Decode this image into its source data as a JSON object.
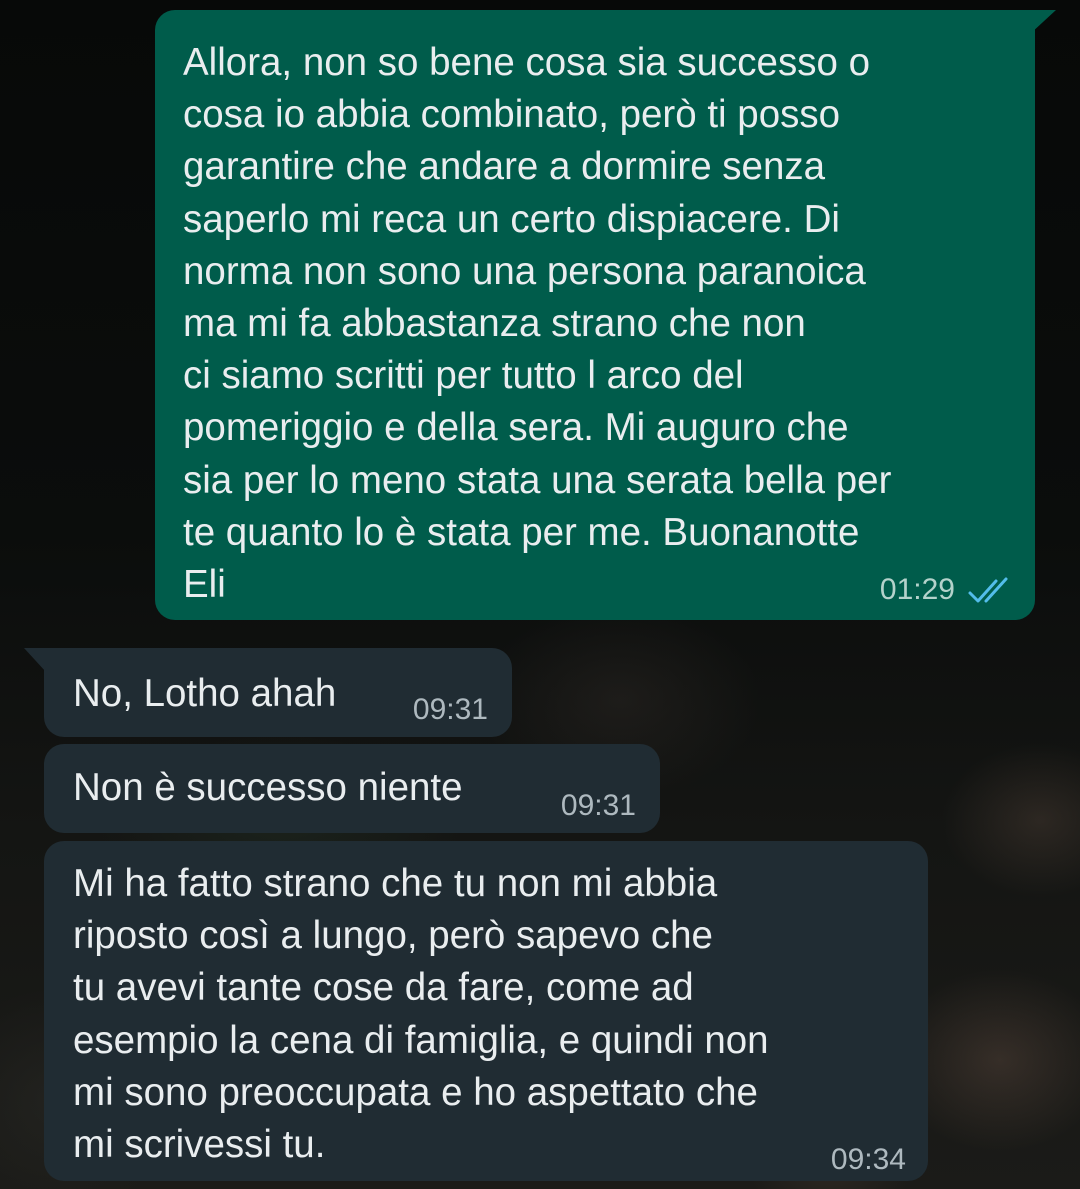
{
  "chat": {
    "messages": [
      {
        "direction": "outgoing",
        "text": "Allora, non so bene cosa sia successo o\ncosa io abbia combinato, però ti posso\ngarantire che andare a dormire senza\nsaperlo mi reca un certo dispiacere. Di\nnorma non sono una persona paranoica\nma mi fa abbastanza strano che non\nci siamo scritti per tutto l arco del\npomeriggio e della sera. Mi auguro che\nsia per lo meno stata una serata bella per\nte quanto lo è stata per me. Buonanotte\nEli",
        "time": "01:29",
        "status_icon": "double-check-read-icon"
      },
      {
        "direction": "incoming",
        "text": "No, Lotho ahah",
        "time": "09:31"
      },
      {
        "direction": "incoming",
        "text": "Non è successo niente",
        "time": "09:31"
      },
      {
        "direction": "incoming",
        "text": "Mi ha fatto strano che tu non mi abbia\nriposto così a lungo, però sapevo che\ntu avevi tante cose da fare, come ad\nesempio la cena di famiglia, e quindi non\nmi sono preoccupata e ho aspettato che\nmi scrivessi tu.",
        "time": "09:34"
      }
    ]
  },
  "colors": {
    "outgoing_bubble": "#005c4b",
    "incoming_bubble": "#202c33",
    "message_text": "#e9edef",
    "read_ticks": "#53bdeb"
  }
}
